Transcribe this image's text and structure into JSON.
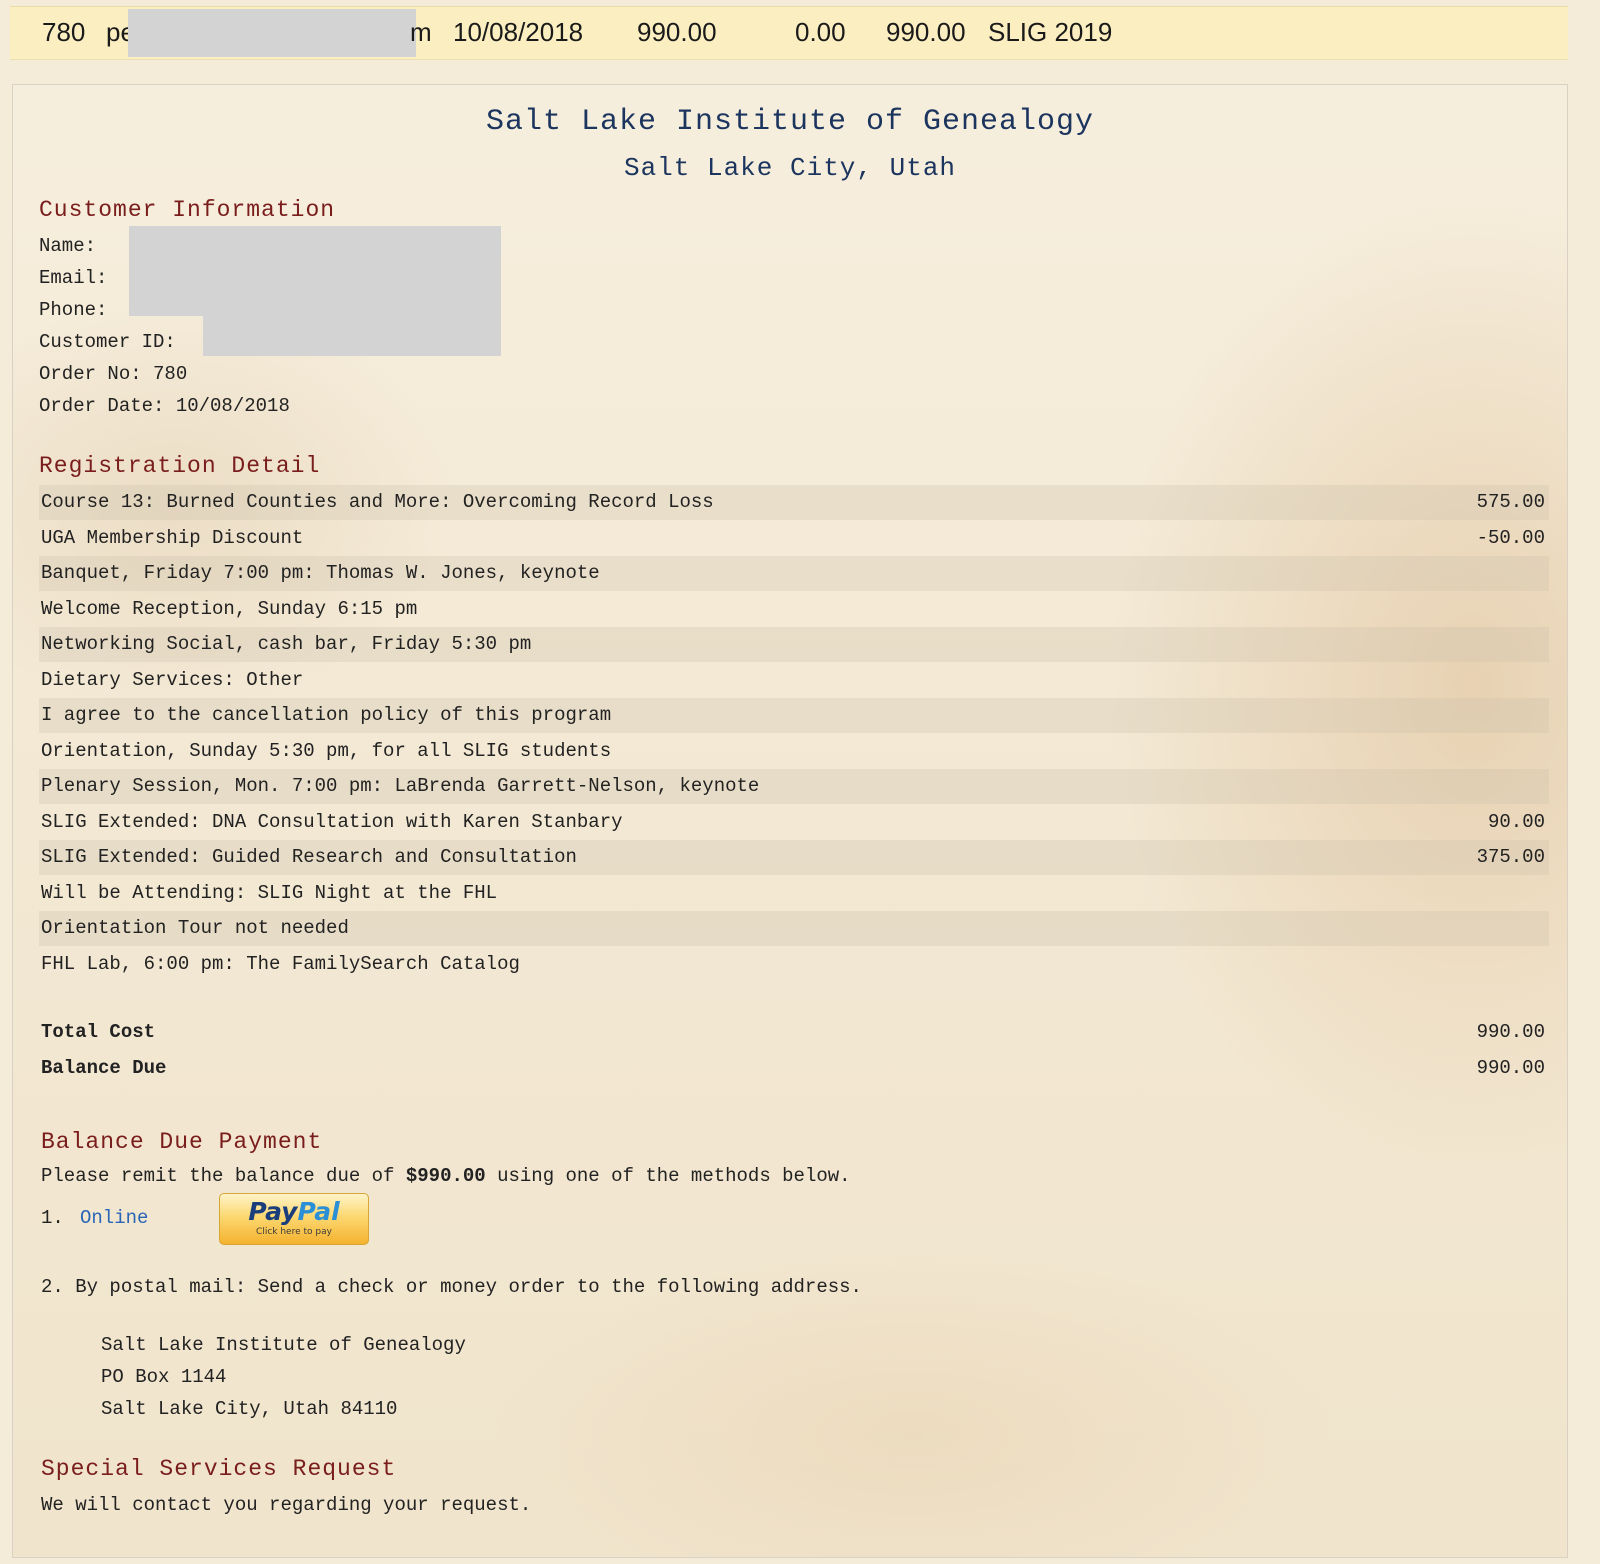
{
  "order_strip": {
    "order_no": "780",
    "name_prefix": "pe",
    "name_suffix": "m",
    "date": "10/08/2018",
    "total": "990.00",
    "paid": "0.00",
    "balance": "990.00",
    "event": "SLIG 2019"
  },
  "invoice": {
    "title": "Salt Lake Institute of Genealogy",
    "subtitle": "Salt Lake City, Utah",
    "customer": {
      "heading": "Customer Information",
      "name_label": "Name:",
      "email_label": "Email:",
      "phone_label": "Phone:",
      "customer_id_label": "Customer ID:",
      "order_no_label": "Order No: 780",
      "order_date_label": "Order Date: 10/08/2018"
    },
    "registration": {
      "heading": "Registration Detail",
      "items": [
        {
          "description": "Course 13: Burned Counties and More: Overcoming Record Loss",
          "amount": "575.00"
        },
        {
          "description": "UGA Membership Discount",
          "amount": "-50.00"
        },
        {
          "description": "Banquet, Friday 7:00 pm: Thomas W. Jones, keynote",
          "amount": ""
        },
        {
          "description": "Welcome Reception, Sunday 6:15 pm",
          "amount": ""
        },
        {
          "description": "Networking Social, cash bar, Friday 5:30 pm",
          "amount": ""
        },
        {
          "description": "Dietary Services: Other",
          "amount": ""
        },
        {
          "description": "I agree to the cancellation policy of this program",
          "amount": ""
        },
        {
          "description": "Orientation, Sunday 5:30 pm, for all SLIG students",
          "amount": ""
        },
        {
          "description": "Plenary Session, Mon. 7:00 pm: LaBrenda Garrett-Nelson, keynote",
          "amount": ""
        },
        {
          "description": "SLIG Extended: DNA Consultation with Karen Stanbary",
          "amount": "90.00"
        },
        {
          "description": "SLIG Extended: Guided Research and Consultation",
          "amount": "375.00"
        },
        {
          "description": "Will be Attending: SLIG Night at the FHL",
          "amount": ""
        },
        {
          "description": "Orientation Tour not needed",
          "amount": ""
        },
        {
          "description": "FHL Lab, 6:00 pm: The FamilySearch Catalog",
          "amount": ""
        }
      ],
      "total_cost_label": "Total Cost",
      "total_cost": "990.00",
      "balance_due_label": "Balance Due",
      "balance_due": "990.00"
    },
    "payment": {
      "heading": "Balance Due Payment",
      "remit_prefix": "Please remit the balance due of ",
      "remit_amount": "$990.00",
      "remit_suffix": " using one of the methods below.",
      "online_number": "1.",
      "online_link": "Online",
      "paypal_pay": "Pay",
      "paypal_pal": "Pal",
      "paypal_sub": "Click here to pay",
      "postal_text": "2. By postal mail: Send a check or money order to the following address.",
      "address": [
        "Salt Lake Institute of Genealogy",
        "PO Box 1144",
        "Salt Lake City, Utah 84110"
      ]
    },
    "special": {
      "heading": "Special Services Request",
      "text": "We will contact you regarding your request."
    }
  },
  "colors": {
    "strip_bg": "#fbeec0",
    "heading": "#7a1d1d",
    "title": "#1c355e",
    "link": "#2a66b8",
    "redaction": "#d3d3d3"
  }
}
